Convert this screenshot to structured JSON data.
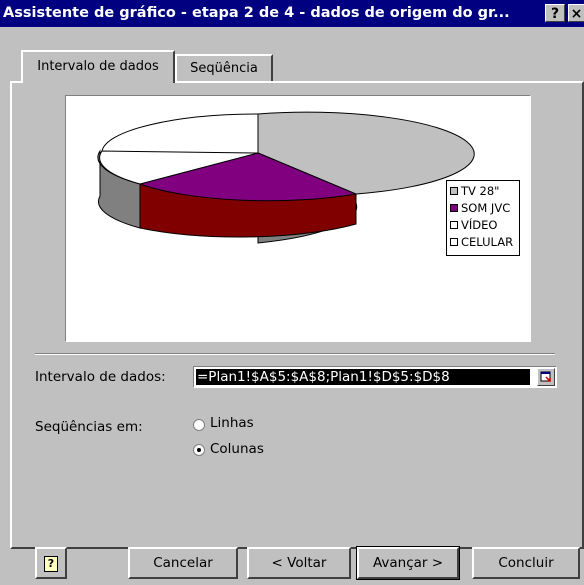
{
  "window": {
    "title": "Assistente de gráfico - etapa 2 de 4 - dados de origem do gr...",
    "help_label": "?",
    "close_label": "×"
  },
  "tabs": [
    {
      "label": "Intervalo de dados",
      "active": true
    },
    {
      "label": "Seqüência",
      "active": false
    }
  ],
  "chart_data": {
    "type": "pie",
    "style": "3d-pie",
    "categories": [
      "TV 28\"",
      "SOM JVC",
      "VÍDEO",
      "CELULAR"
    ],
    "colors": [
      "#c0c0c0",
      "#800080",
      "#ffffff",
      "#ffffff"
    ],
    "legend_position": "right"
  },
  "legend": [
    "TV 28\"",
    "SOM JVC",
    "VÍDEO",
    "CELULAR"
  ],
  "range": {
    "label": "Intervalo de dados:",
    "value": "=Plan1!$A$5:$A$8;Plan1!$D$5:$D$8"
  },
  "series_in": {
    "label": "Seqüências em:",
    "options": [
      {
        "label": "Linhas",
        "selected": false
      },
      {
        "label": "Colunas",
        "selected": true
      }
    ]
  },
  "buttons": {
    "help": "?",
    "cancel": "Cancelar",
    "back": "< Voltar",
    "next": "Avançar >",
    "finish": "Concluir"
  }
}
